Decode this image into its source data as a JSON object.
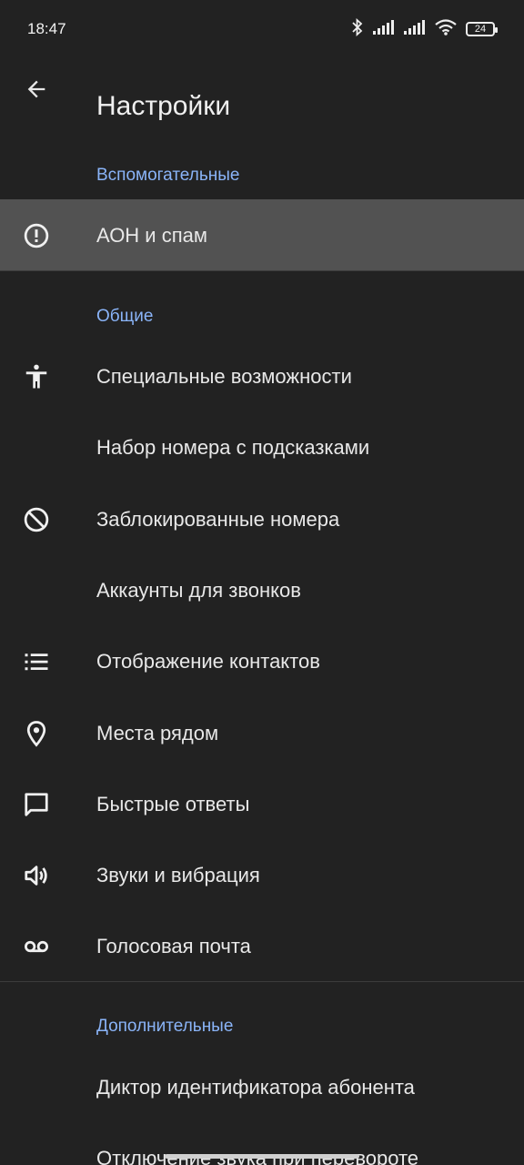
{
  "status_bar": {
    "time": "18:47",
    "battery_level": "24",
    "icons": [
      "bluetooth-icon",
      "signal-icon",
      "signal-icon",
      "wifi-icon",
      "battery-icon"
    ]
  },
  "app_bar": {
    "back_icon": "arrow-back-icon",
    "title": "Настройки"
  },
  "sections": {
    "auxiliary": {
      "header": "Вспомогательные",
      "items": [
        {
          "label": "АОН и спам",
          "icon": "alert-circle-icon"
        }
      ]
    },
    "general": {
      "header": "Общие",
      "items": [
        {
          "label": "Специальные возможности",
          "icon": "accessibility-icon"
        },
        {
          "label": "Набор номера с подсказками",
          "icon": ""
        },
        {
          "label": "Заблокированные номера",
          "icon": "block-icon"
        },
        {
          "label": "Аккаунты для звонков",
          "icon": ""
        },
        {
          "label": "Отображение контактов",
          "icon": "list-icon"
        },
        {
          "label": "Места рядом",
          "icon": "location-pin-icon"
        },
        {
          "label": "Быстрые ответы",
          "icon": "message-icon"
        },
        {
          "label": "Звуки и вибрация",
          "icon": "volume-icon"
        },
        {
          "label": "Голосовая почта",
          "icon": "voicemail-icon"
        }
      ]
    },
    "additional": {
      "header": "Дополнительные",
      "items": [
        {
          "label": "Диктор идентификатора абонента",
          "icon": ""
        },
        {
          "label": "Отключение звука при перевороте",
          "icon": ""
        }
      ]
    }
  },
  "colors": {
    "background": "#222222",
    "accent": "#8ab4f8",
    "highlight": "#525252"
  }
}
